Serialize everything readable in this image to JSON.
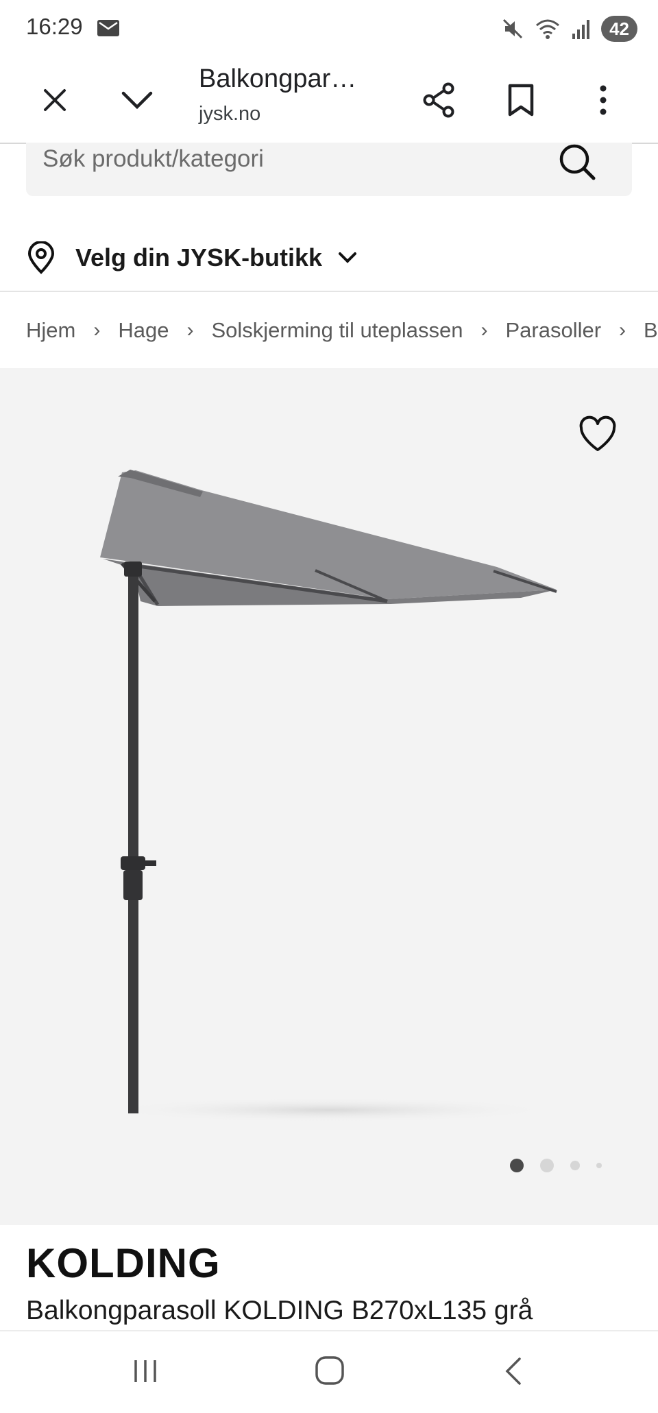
{
  "status_bar": {
    "time": "16:29",
    "battery": "42",
    "icons": [
      "mail-icon",
      "mute-icon",
      "wifi-icon",
      "signal-icon"
    ]
  },
  "browser": {
    "title": "Balkongpar…",
    "domain": "jysk.no",
    "icons": [
      "close-icon",
      "chevron-down-icon",
      "share-icon",
      "bookmark-icon",
      "more-vert-icon"
    ]
  },
  "search": {
    "placeholder": "Søk produkt/kategori"
  },
  "store": {
    "label": "Velg din JYSK-butikk"
  },
  "breadcrumbs": [
    "Hjem",
    "Hage",
    "Solskjerming til uteplassen",
    "Parasoller",
    "B"
  ],
  "product": {
    "brand": "KOLDING",
    "name": "Balkongparasoll KOLDING B270xL135 grå",
    "image_dots": 4,
    "active_dot": 0
  },
  "colors": {
    "image_bg": "#f3f3f3",
    "canopy": "#8a8a8c",
    "pole": "#3a3a3c"
  }
}
